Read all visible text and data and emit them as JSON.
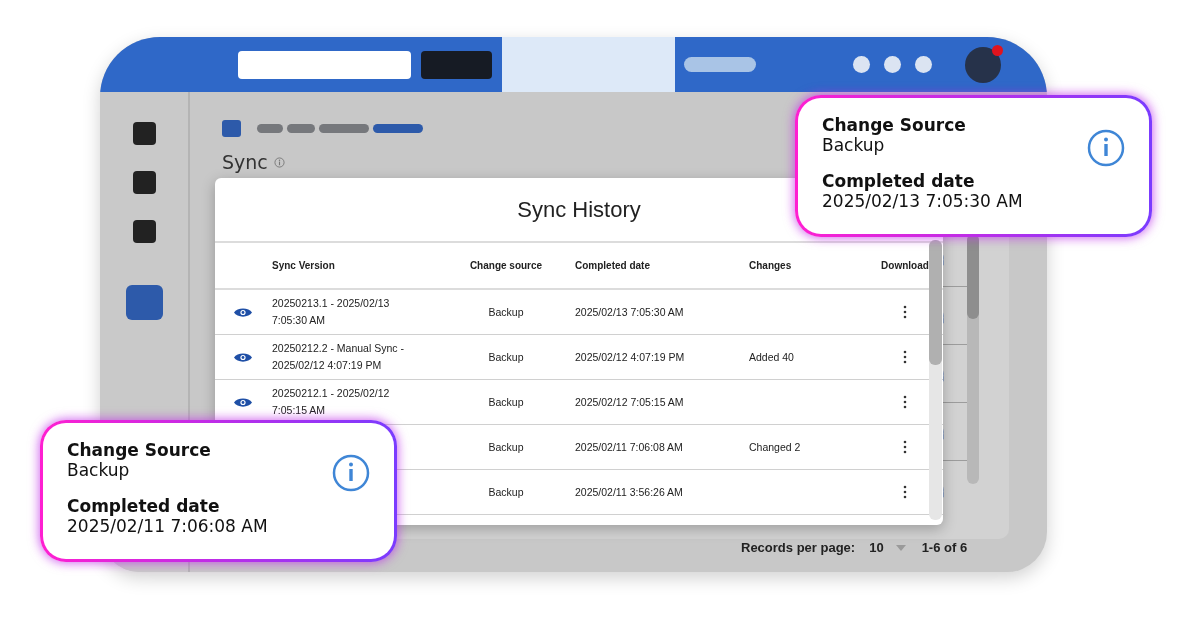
{
  "sidebar": {
    "items": [
      {
        "selected": false
      },
      {
        "selected": false
      },
      {
        "selected": false
      },
      {
        "selected": true
      }
    ]
  },
  "page_title": "Sync",
  "modal": {
    "title": "Sync History",
    "columns": [
      "Sync Version",
      "Change source",
      "Completed date",
      "Changes",
      "Download"
    ],
    "rows": [
      {
        "version": "20250213.1 - 2025/02/13 7:05:30 AM",
        "source": "Backup",
        "date": "2025/02/13 7:05:30 AM"
      },
      {
        "version": "20250212.2 - Manual Sync - 2025/02/12 4:07:19 PM",
        "source": "Backup",
        "date": "2025/02/12 4:07:19 PM",
        "changes": "Added 40"
      },
      {
        "version": "20250212.1 - 2025/02/12 7:05:15 AM",
        "source": "Backup",
        "date": "2025/02/12 7:05:15 AM"
      },
      {
        "source": "Backup",
        "date": "2025/02/11 7:06:08 AM",
        "changes": "Changed 2"
      },
      {
        "source": "Backup",
        "date": "2025/02/11 3:56:26 AM"
      }
    ]
  },
  "pagination": {
    "label": "Records per page:",
    "per_page": "10",
    "range": "1-6 of 6"
  },
  "callouts": [
    {
      "label_1": "Change Source",
      "value_1": "Backup",
      "label_2": "Completed date",
      "value_2": "2025/02/13 7:05:30 AM"
    },
    {
      "label_1": "Change Source",
      "value_1": "Backup",
      "label_2": "Completed date",
      "value_2": "2025/02/11 7:06:08 AM"
    }
  ]
}
